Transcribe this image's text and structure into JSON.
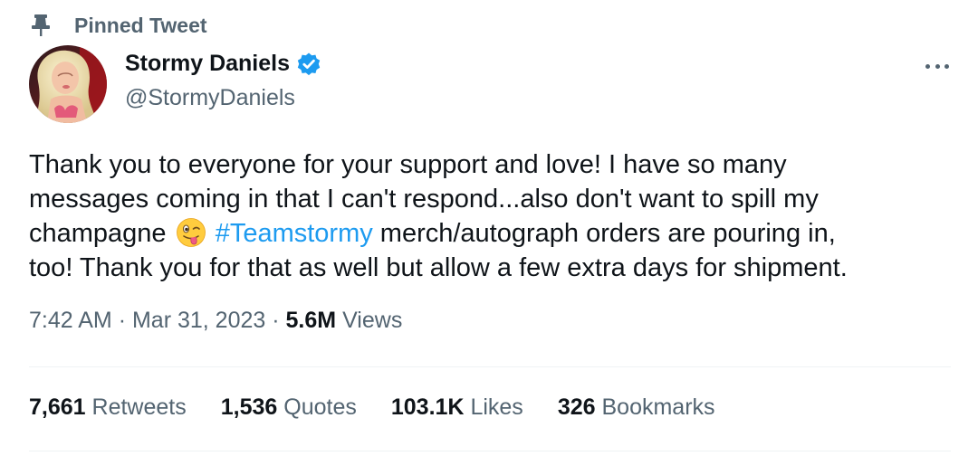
{
  "pinned": {
    "label": "Pinned Tweet",
    "icon": "pin-icon"
  },
  "author": {
    "name": "Stormy Daniels",
    "handle": "@StormyDaniels",
    "verified": true,
    "verified_color": "#1d9bf0"
  },
  "tweet": {
    "line1": "Thank you to everyone for your support and love! I have so many",
    "line2": "messages coming in that I can't respond...also don't want to spill my",
    "line3_before": "champagne",
    "emoji": "winking-face-with-tongue",
    "hashtag": "#Teamstormy",
    "line3_after": "merch/autograph orders are pouring in,",
    "line4": "too! Thank you for that as well but allow a few extra days for shipment."
  },
  "meta": {
    "time": "7:42 AM",
    "separator": "·",
    "date": "Mar 31, 2023",
    "views_count": "5.6M",
    "views_label": "Views"
  },
  "stats": [
    {
      "count": "7,661",
      "label": "Retweets"
    },
    {
      "count": "1,536",
      "label": "Quotes"
    },
    {
      "count": "103.1K",
      "label": "Likes"
    },
    {
      "count": "326",
      "label": "Bookmarks"
    }
  ],
  "colors": {
    "text": "#0f1419",
    "secondary": "#536471",
    "link": "#1d9bf0",
    "divider": "#eff3f4"
  }
}
